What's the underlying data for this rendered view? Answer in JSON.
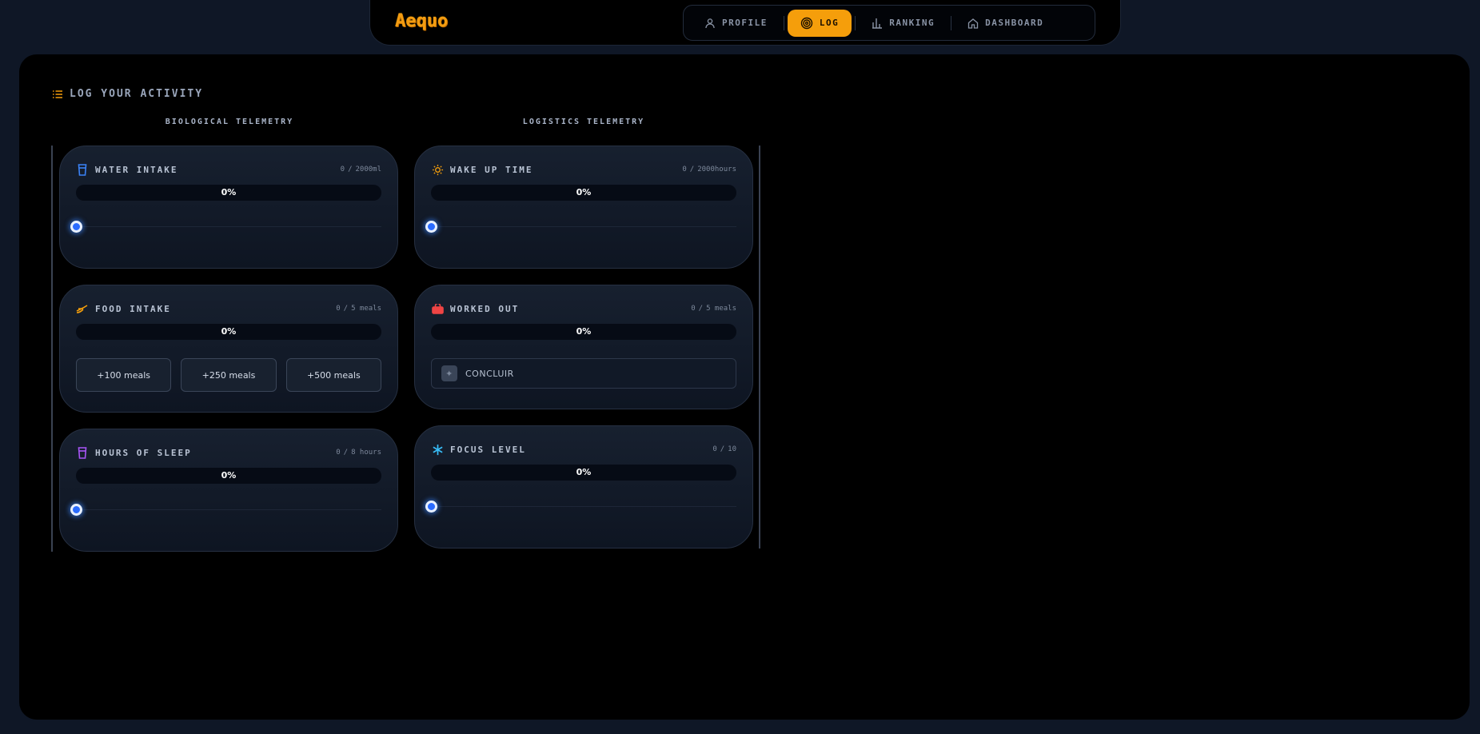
{
  "app": {
    "logo": "Aequo"
  },
  "nav": {
    "items": [
      {
        "label": "PROFILE",
        "icon": "user-icon",
        "active": false
      },
      {
        "label": "LOG",
        "icon": "target-icon",
        "active": true
      },
      {
        "label": "RANKING",
        "icon": "bar-chart-icon",
        "active": false
      },
      {
        "label": "DASHBOARD",
        "icon": "home-icon",
        "active": false
      }
    ]
  },
  "page": {
    "title": "LOG YOUR ACTIVITY",
    "columns": [
      "BIOLOGICAL TELEMETRY",
      "LOGISTICS TELEMETRY"
    ]
  },
  "cards": {
    "water": {
      "title": "WATER INTAKE",
      "current": "0",
      "target": "2000ml",
      "percent_label": "0%",
      "progress": 0,
      "slider_value": 0,
      "icon": "glass-icon",
      "icon_color": "#3b82f6"
    },
    "food": {
      "title": "FOOD INTAKE",
      "current": "0",
      "target": "5 meals",
      "percent_label": "0%",
      "progress": 0,
      "icon": "food-icon",
      "icon_color": "#f59e0b",
      "buttons": [
        "+100 meals",
        "+250 meals",
        "+500 meals"
      ]
    },
    "sleep": {
      "title": "HOURS OF SLEEP",
      "current": "0",
      "target": "8 hours",
      "percent_label": "0%",
      "progress": 0,
      "slider_value": 0,
      "icon": "glass-icon",
      "icon_color": "#a855f7"
    },
    "wake": {
      "title": "WAKE UP TIME",
      "current": "0",
      "target": "2000hours",
      "percent_label": "0%",
      "progress": 0,
      "slider_value": 0,
      "icon": "sun-icon",
      "icon_color": "#f59e0b"
    },
    "workout": {
      "title": "WORKED OUT",
      "current": "0",
      "target": "5 meals",
      "percent_label": "0%",
      "progress": 0,
      "icon": "bag-icon",
      "icon_color": "#ef4444",
      "button_label": "CONCLUIR"
    },
    "focus": {
      "title": "FOCUS LEVEL",
      "current": "0",
      "target": "10",
      "percent_label": "0%",
      "progress": 0,
      "slider_value": 0,
      "icon": "asterisk-icon",
      "icon_color": "#38bdf8"
    }
  },
  "colors": {
    "accent": "#f59e0b",
    "slider": "#2a6bff",
    "background": "#0f1726",
    "panel": "#000000"
  }
}
